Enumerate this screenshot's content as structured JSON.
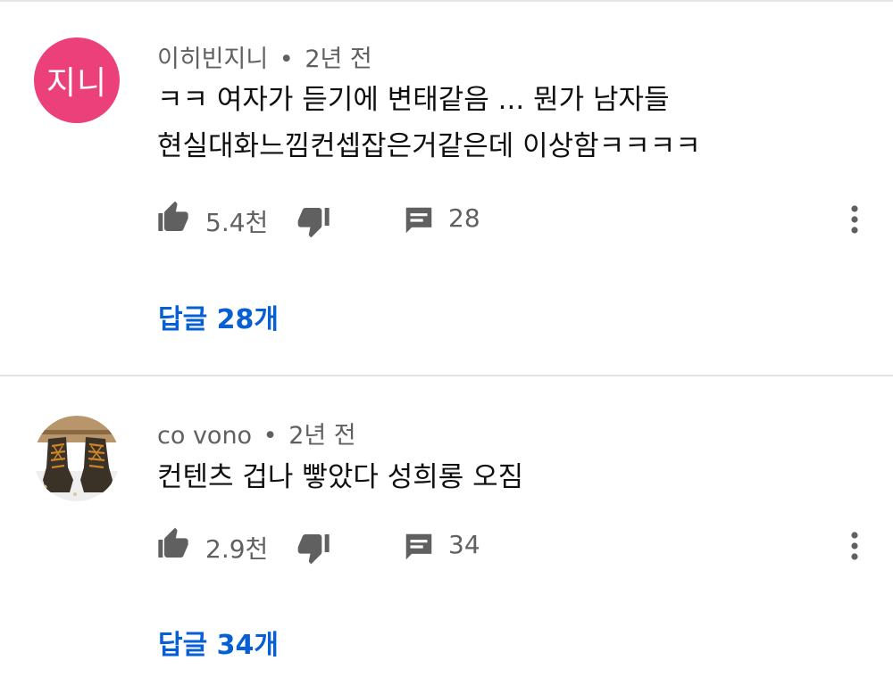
{
  "comments": [
    {
      "avatar_text": "지니",
      "author": "이히빈지니",
      "separator": "•",
      "time": "2년 전",
      "lines": [
        "ㅋㅋ 여자가 듣기에 변태같음 ... 뭔가 남자들",
        "현실대화느낌컨셉잡은거같은데 이상함ㅋㅋㅋㅋ"
      ],
      "likes": "5.4천",
      "reply_count": "28",
      "replies_label": "답글 28개"
    },
    {
      "author": "co vono",
      "separator": "•",
      "time": "2년 전",
      "lines": [
        "컨텐츠 겁나 빻았다 성희롱 오짐"
      ],
      "likes": "2.9천",
      "reply_count": "34",
      "replies_label": "답글 34개"
    }
  ],
  "colors": {
    "avatar_pink": "#ec407a",
    "link_blue": "#065fd4",
    "secondary_text": "#606060",
    "icon_gray": "#606060"
  },
  "icons": {
    "like": "thumb-up-icon",
    "dislike": "thumb-down-icon",
    "reply": "comment-icon",
    "more": "more-vertical-icon"
  }
}
